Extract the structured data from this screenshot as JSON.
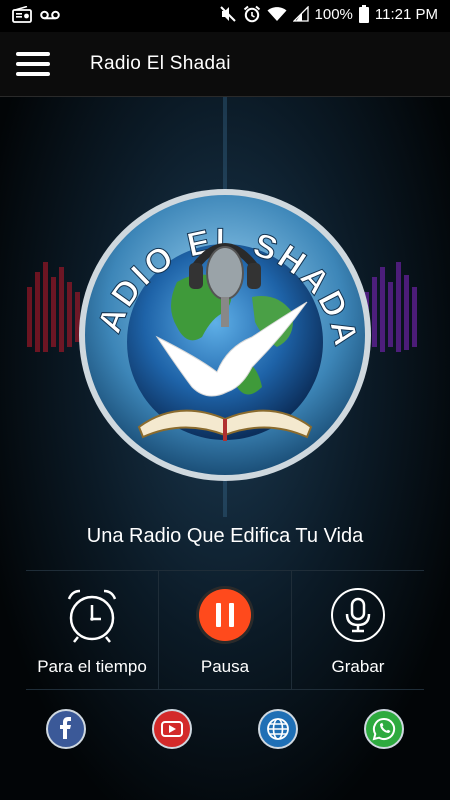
{
  "status_bar": {
    "battery": "100%",
    "time": "11:21 PM",
    "icons": [
      "radio-icon",
      "voicemail-icon",
      "mute-icon",
      "alarm-icon",
      "wifi-icon",
      "signal-icon",
      "battery-icon"
    ]
  },
  "app_bar": {
    "title": "Radio El Shadai",
    "menu_icon": "hamburger-menu-icon"
  },
  "logo": {
    "text": "RADIO EL SHADAI"
  },
  "tagline": "Una Radio Que Edifica Tu Vida",
  "controls": [
    {
      "label": "Para el tiempo",
      "icon": "alarm-clock-icon"
    },
    {
      "label": "Pausa",
      "icon": "pause-icon"
    },
    {
      "label": "Grabar",
      "icon": "microphone-icon"
    }
  ],
  "social": [
    {
      "icon": "facebook-icon"
    },
    {
      "icon": "youtube-icon"
    },
    {
      "icon": "globe-icon"
    },
    {
      "icon": "whatsapp-icon"
    }
  ],
  "colors": {
    "pause_button": "#ff4a1c",
    "facebook": "#3b5998",
    "youtube": "#d32a2a",
    "web": "#1f6fb5",
    "whatsapp": "#2eaa3f"
  }
}
